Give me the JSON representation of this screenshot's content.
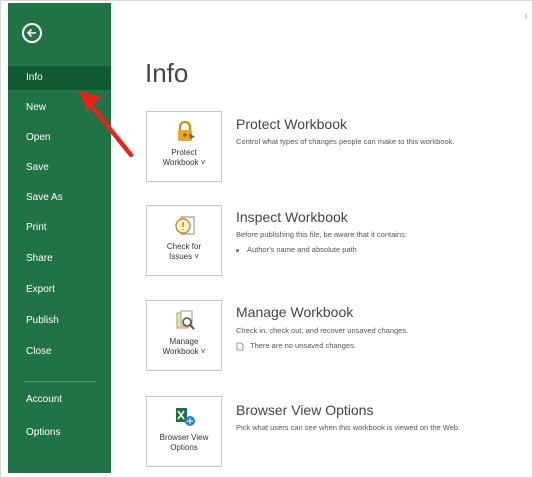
{
  "sidebar": {
    "back_label": "",
    "items": [
      {
        "label": "Info",
        "active": true
      },
      {
        "label": "New"
      },
      {
        "label": "Open"
      },
      {
        "label": "Save"
      },
      {
        "label": "Save As"
      },
      {
        "label": "Print"
      },
      {
        "label": "Share"
      },
      {
        "label": "Export"
      },
      {
        "label": "Publish"
      },
      {
        "label": "Close"
      },
      {
        "label": "Account"
      },
      {
        "label": "Options"
      }
    ]
  },
  "main": {
    "title": "Info",
    "sections": [
      {
        "tile_label_1": "Protect",
        "tile_label_2": "Workbook ˅",
        "title": "Protect Workbook",
        "description": "Control what types of changes people can make to this workbook.",
        "icon": "lock-icon"
      },
      {
        "tile_label_1": "Check for",
        "tile_label_2": "Issues ˅",
        "title": "Inspect Workbook",
        "description": "Before publishing this file, be aware that it contains:",
        "bullet": "Author's name and absolute path",
        "icon": "inspect-icon"
      },
      {
        "tile_label_1": "Manage",
        "tile_label_2": "Workbook ˅",
        "title": "Manage Workbook",
        "description": "Check in, check out, and recover unsaved changes.",
        "bullet": "There are no unsaved changes.",
        "icon": "manage-workbook-icon"
      },
      {
        "tile_label_1": "Browser View",
        "tile_label_2": "Options",
        "title": "Browser View Options",
        "description": "Pick what users can see when this workbook is viewed on the Web.",
        "icon": "browser-view-icon"
      }
    ]
  },
  "corner_mark": "I",
  "colors": {
    "sidebar": "#217346",
    "sidebar_active": "#0f5a31",
    "arrow": "#e8231f"
  }
}
